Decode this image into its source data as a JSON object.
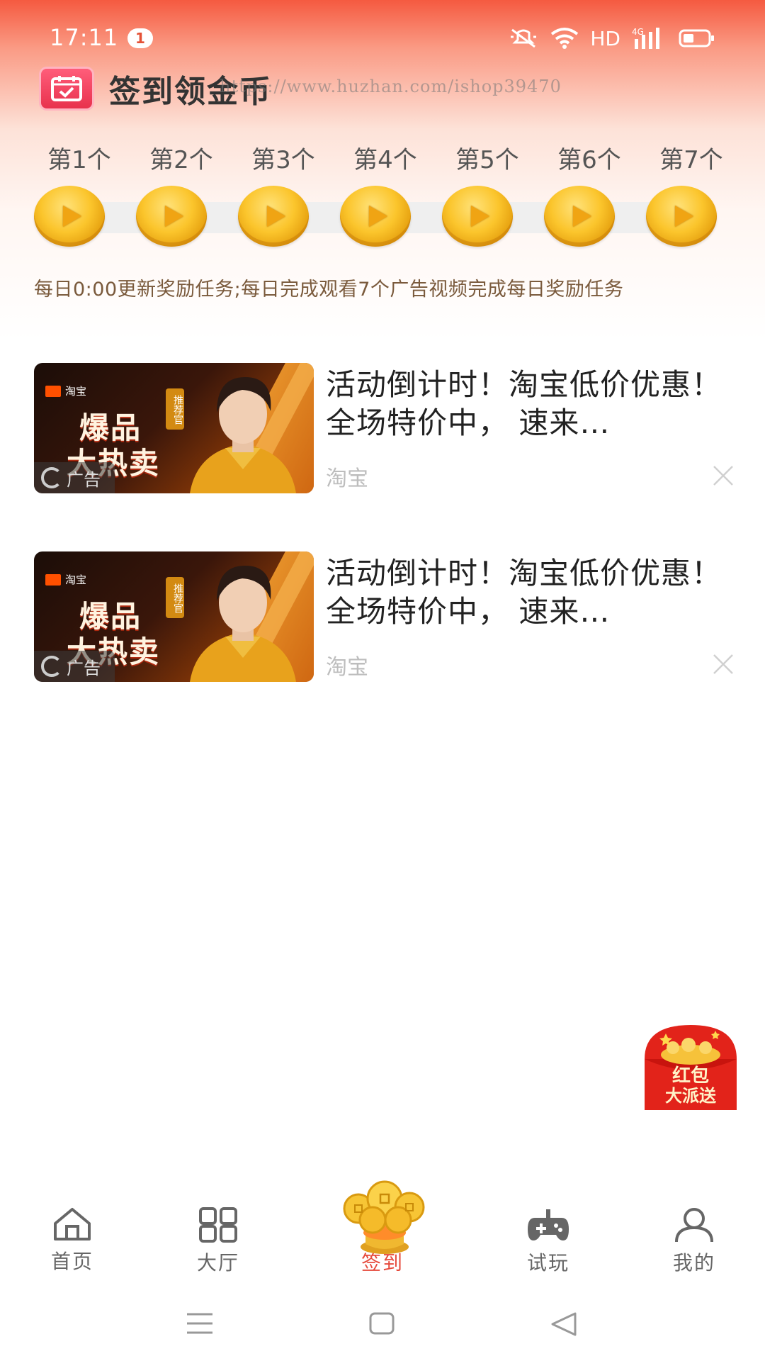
{
  "status_bar": {
    "time": "17:11",
    "notification_count": "1",
    "network_label": "HD",
    "network_type": "4G",
    "icons": [
      "mute-icon",
      "wifi-icon",
      "signal-icon",
      "battery-icon"
    ]
  },
  "header": {
    "title": "签到领金币",
    "watermark": "https://www.huzhan.com/ishop39470"
  },
  "checkin": {
    "days": [
      {
        "label": "第1个"
      },
      {
        "label": "第2个"
      },
      {
        "label": "第3个"
      },
      {
        "label": "第4个"
      },
      {
        "label": "第5个"
      },
      {
        "label": "第6个"
      },
      {
        "label": "第7个"
      }
    ],
    "rule_text": "每日0:00更新奖励任务;每日完成观看7个广告视频完成每日奖励任务"
  },
  "ads": [
    {
      "title": "活动倒计时！淘宝低价优惠！全场特价中， 速来…",
      "source": "淘宝",
      "ad_label": "广告",
      "thumb_brand": "淘宝",
      "thumb_line1": "爆品",
      "thumb_line2": "大热卖",
      "thumb_badge": "推荐官"
    },
    {
      "title": "活动倒计时！淘宝低价优惠！全场特价中， 速来…",
      "source": "淘宝",
      "ad_label": "广告",
      "thumb_brand": "淘宝",
      "thumb_line1": "爆品",
      "thumb_line2": "大热卖",
      "thumb_badge": "推荐官"
    }
  ],
  "red_packet": {
    "line1": "红包",
    "line2": "大派送"
  },
  "bottom_nav": {
    "items": [
      {
        "label": "首页",
        "icon": "home-icon",
        "active": false
      },
      {
        "label": "大厅",
        "icon": "grid-icon",
        "active": false
      },
      {
        "label": "签到",
        "icon": "coins-icon",
        "active": true
      },
      {
        "label": "试玩",
        "icon": "gamepad-icon",
        "active": false
      },
      {
        "label": "我的",
        "icon": "user-icon",
        "active": false
      }
    ]
  },
  "colors": {
    "accent": "#e64a3c",
    "header_gradient_top": "#f55a40",
    "coin_gold": "#fbc52c",
    "rule_text": "#7a5a3c"
  }
}
